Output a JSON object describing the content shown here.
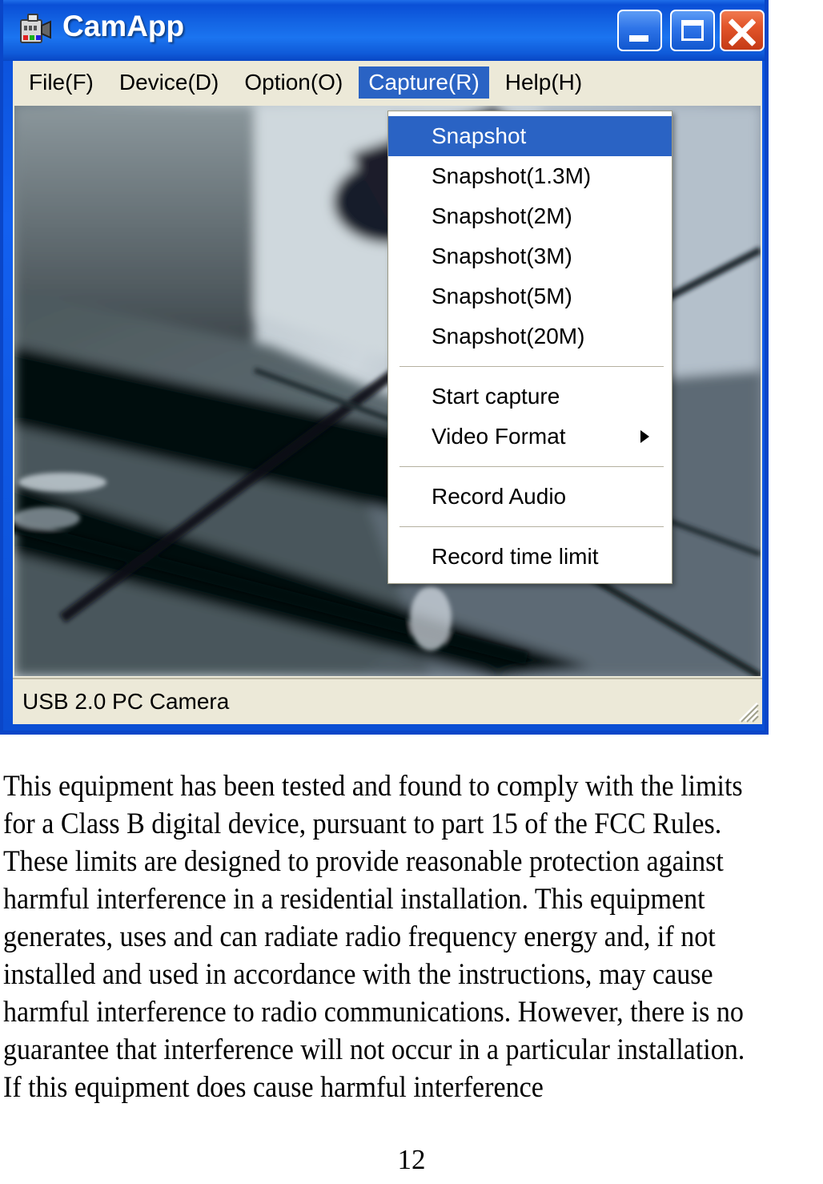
{
  "window": {
    "title": "CamApp",
    "icon": "camera-icon",
    "controls": {
      "minimize_label": "_",
      "maximize_label": "□",
      "close_label": "X"
    },
    "status_bar": {
      "device_text": "USB 2.0 PC Camera",
      "resize_grip": "resize-grip-icon"
    }
  },
  "menubar": {
    "items": [
      {
        "label": "File(F)",
        "active": false
      },
      {
        "label": "Device(D)",
        "active": false
      },
      {
        "label": "Option(O)",
        "active": false
      },
      {
        "label": "Capture(R)",
        "active": true
      },
      {
        "label": "Help(H)",
        "active": false
      }
    ]
  },
  "capture_menu": {
    "open": true,
    "items": [
      {
        "label": "Snapshot",
        "selected": true,
        "submenu": false
      },
      {
        "label": "Snapshot(1.3M)",
        "selected": false,
        "submenu": false
      },
      {
        "label": "Snapshot(2M)",
        "selected": false,
        "submenu": false
      },
      {
        "label": "Snapshot(3M)",
        "selected": false,
        "submenu": false
      },
      {
        "label": "Snapshot(5M)",
        "selected": false,
        "submenu": false
      },
      {
        "label": "Snapshot(20M)",
        "selected": false,
        "submenu": false
      },
      {
        "separator": true
      },
      {
        "label": "Start capture",
        "selected": false,
        "submenu": false
      },
      {
        "label": "Video Format",
        "selected": false,
        "submenu": true
      },
      {
        "separator": true
      },
      {
        "label": "Record Audio",
        "selected": false,
        "submenu": false
      },
      {
        "separator": true
      },
      {
        "label": "Record time limit",
        "selected": false,
        "submenu": false
      }
    ]
  },
  "video_preview": {
    "description": "live-camera-preview"
  },
  "document": {
    "paragraph": "This equipment has been tested and found to comply with the limits for a Class B digital device, pursuant to part 15 of the FCC Rules. These limits are designed to provide reasonable protection against harmful interference in a residential installation. This equipment generates, uses and can radiate radio frequency energy and, if not installed and used in accordance with the instructions, may cause harmful interference to radio communications. However, there is no guarantee that interference will not occur in a particular installation. If this equipment does cause harmful interference",
    "page_number": "12"
  },
  "colors": {
    "title_bar_blue": "#1568e6",
    "menu_highlight": "#2a63c4",
    "chrome_beige": "#ece9d8",
    "close_button_red": "#e2552a"
  }
}
